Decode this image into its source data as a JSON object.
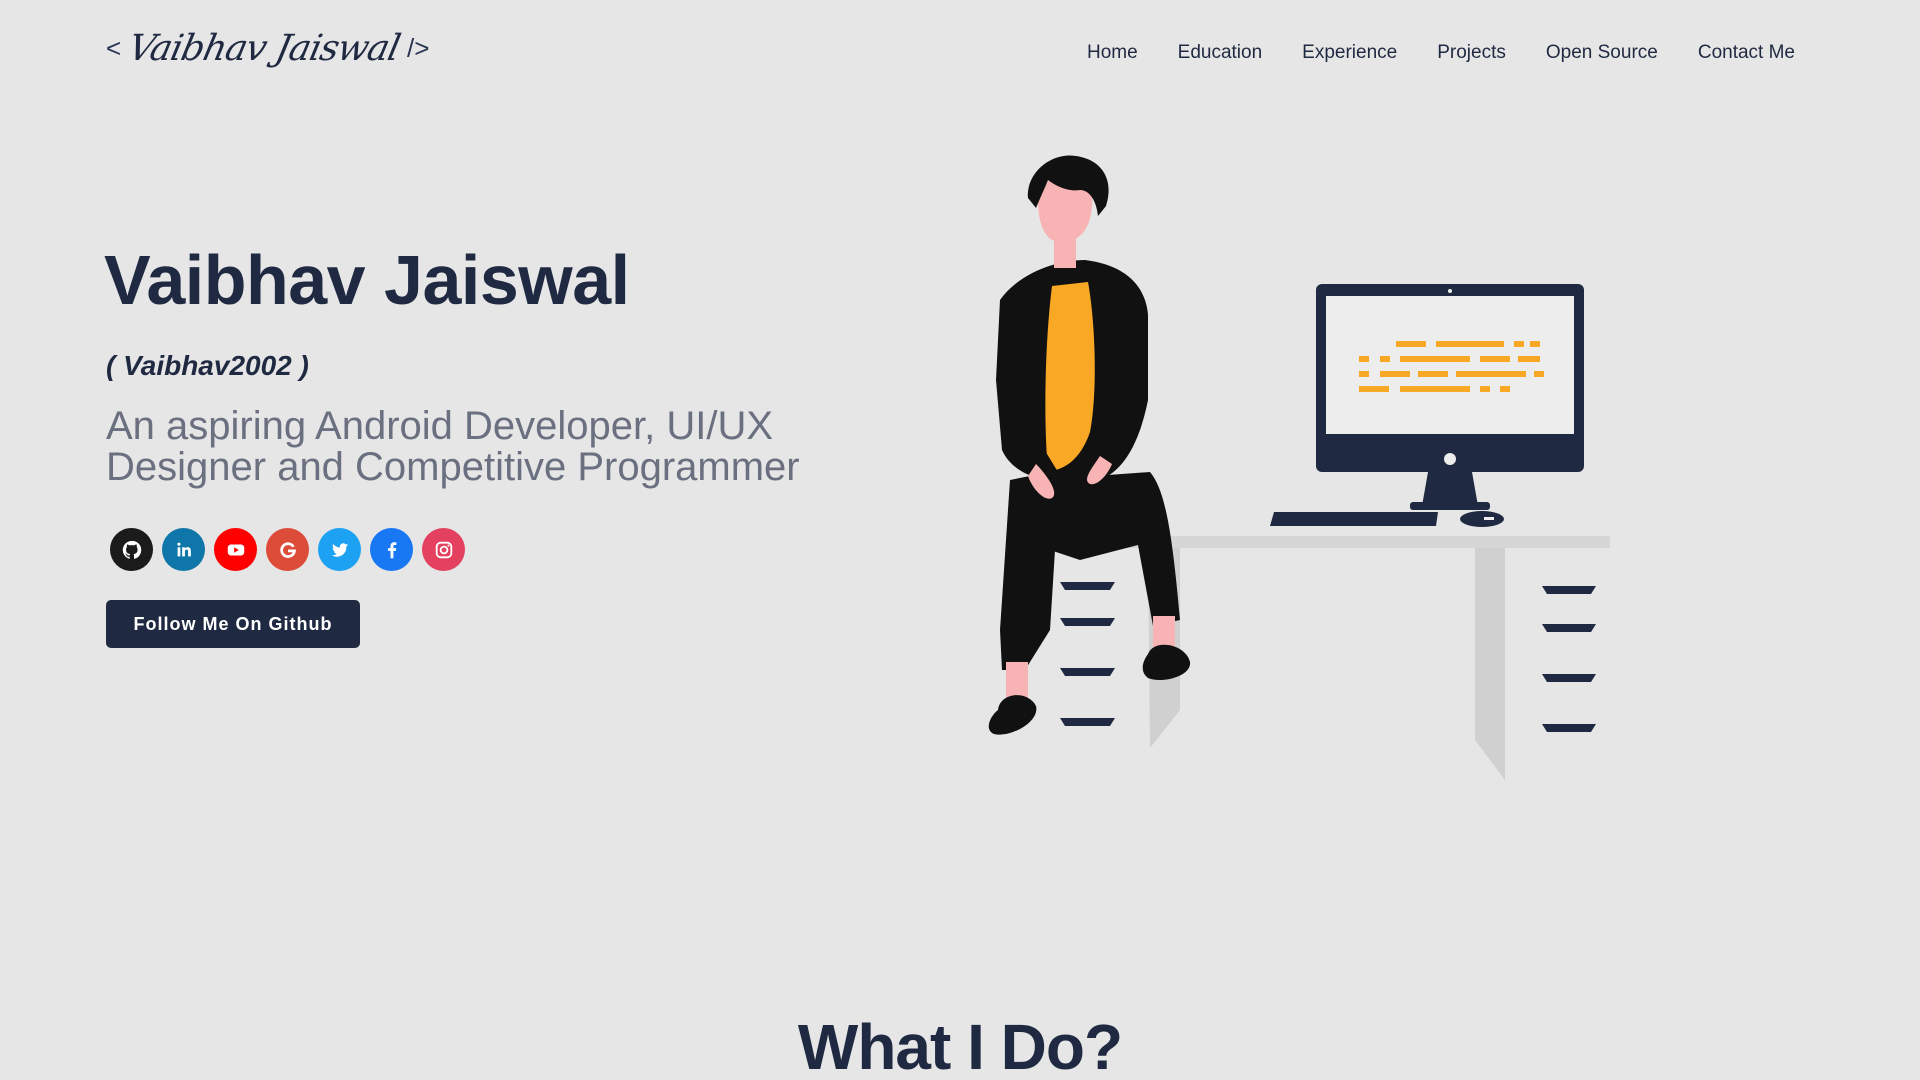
{
  "header": {
    "logo": {
      "open": "<",
      "signature": "Vaibhav Jaiswal",
      "close": "/>"
    },
    "nav": [
      "Home",
      "Education",
      "Experience",
      "Projects",
      "Open Source",
      "Contact Me"
    ]
  },
  "hero": {
    "name": "Vaibhav Jaiswal",
    "handle": "( Vaibhav2002 )",
    "subtitle": "An aspiring Android Developer, UI/UX Designer and Competitive Programmer",
    "socials": [
      {
        "icon": "github-icon",
        "color": "#1b1b1b"
      },
      {
        "icon": "linkedin-icon",
        "color": "#0e76a8"
      },
      {
        "icon": "youtube-icon",
        "color": "#ff0000"
      },
      {
        "icon": "google-icon",
        "color": "#dd4b39"
      },
      {
        "icon": "twitter-icon",
        "color": "#1da1f2"
      },
      {
        "icon": "facebook-icon",
        "color": "#1877f2"
      },
      {
        "icon": "instagram-icon",
        "color": "#e4405f"
      }
    ],
    "button": "Follow Me On Github"
  },
  "sections": {
    "what_i_do": "What I Do?"
  },
  "colors": {
    "background": "#e6e6e6",
    "primary": "#1f2941",
    "accent": "#f9a826",
    "subtitle": "#6a7080"
  }
}
